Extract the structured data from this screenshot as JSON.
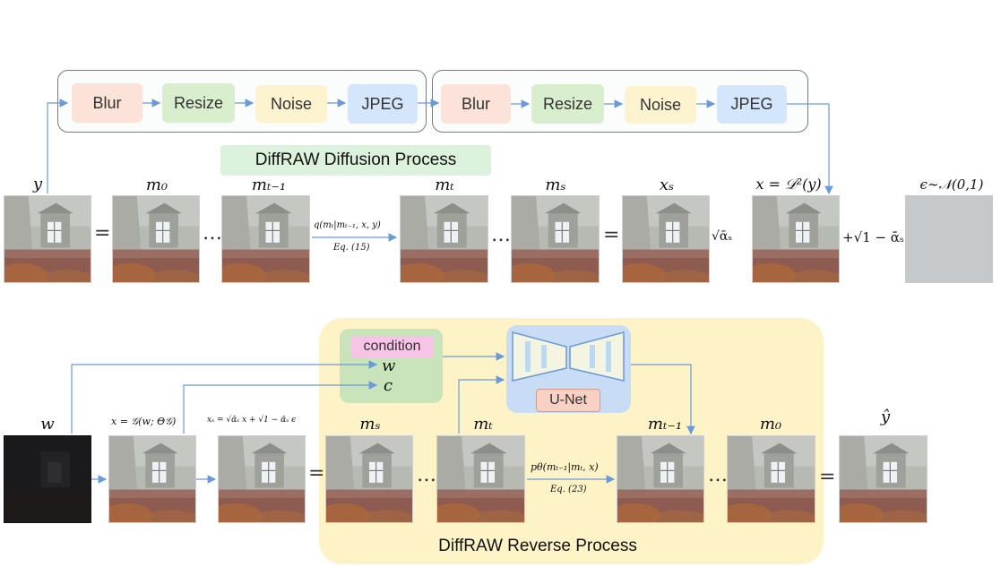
{
  "degradation": {
    "ops_first": [
      "Blur",
      "Resize",
      "Noise",
      "JPEG"
    ],
    "ops_second": [
      "Blur",
      "Resize",
      "Noise",
      "JPEG"
    ]
  },
  "diffusion": {
    "title": "DiffRAW Diffusion Process",
    "labels": {
      "y": "y",
      "m0": "m₀",
      "mt1": "mₜ₋₁",
      "mt": "mₜ",
      "ms": "mₛ",
      "xs": "xₛ",
      "x": "x = 𝒟²(y)",
      "eps": "ϵ∼𝒩(0,1)"
    },
    "transition_label": "q(mₜ|mₜ₋₁, x, y)",
    "transition_eq": "Eq. (15)",
    "sqrt_alpha": "√ᾱₛ",
    "sqrt_one_minus": "+√1 − ᾱₛ",
    "equals": "=",
    "ellipsis": "…"
  },
  "reverse": {
    "title": "DiffRAW Reverse Process",
    "condition_label": "condition",
    "condition_w": "w",
    "condition_c": "c",
    "unet_label": "U-Net",
    "labels": {
      "w": "w",
      "x_gen": "x = 𝒢(w; Θ𝒢)",
      "xs_formula": "xₛ = √ᾱₛ x + √1 − ᾱₛ ϵ",
      "ms": "mₛ",
      "mt": "mₜ",
      "mt1": "mₜ₋₁",
      "m0": "m₀",
      "yhat": "ŷ"
    },
    "transition_label": "pθ(mₜ₋₁|mₜ, x)",
    "transition_eq": "Eq. (23)",
    "equals": "=",
    "ellipsis": "…"
  },
  "colors": {
    "blur": "#fbe3d9",
    "resize": "#d9eecd",
    "noise": "#fdf3cf",
    "jpeg": "#d4e6fb",
    "diffusion_title_bg": "#dcf2dc",
    "reverse_bg": "#fdf3c6",
    "condition_bg": "#c9e3bb",
    "condition_label_bg": "#f7c3e6",
    "unet_bg": "#c8dcf6",
    "unet_label_bg": "#f9d0c4",
    "arrow": "#6a9ad8"
  }
}
